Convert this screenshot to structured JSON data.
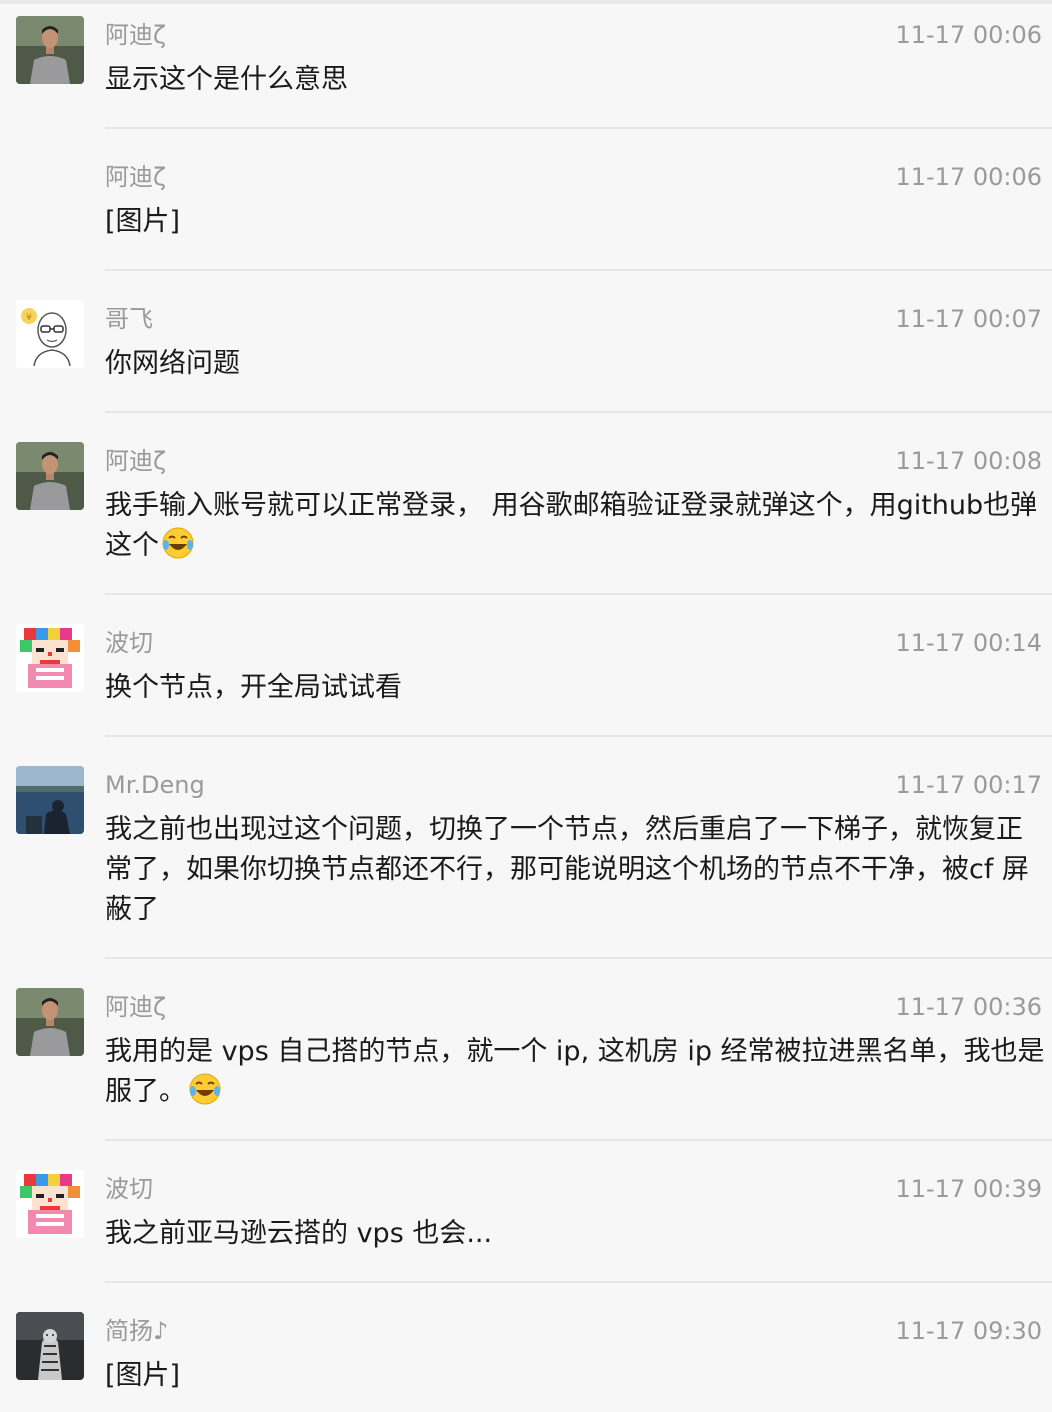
{
  "messages": [
    {
      "sender": "阿迪ζ",
      "time": "11-17 00:06",
      "avatar": "young-man-photo-avatar",
      "parts": [
        {
          "text": "显示这个是什么意思"
        }
      ]
    },
    {
      "sender": "阿迪ζ",
      "time": "11-17 00:06",
      "avatar": "",
      "parts": [
        {
          "text": "[图片]"
        }
      ]
    },
    {
      "sender": "哥飞",
      "time": "11-17 00:07",
      "avatar": "cartoon-glasses-avatar",
      "parts": [
        {
          "text": "你网络问题"
        }
      ]
    },
    {
      "sender": "阿迪ζ",
      "time": "11-17 00:08",
      "avatar": "young-man-photo-avatar",
      "parts": [
        {
          "text": "我手输入账号就可以正常登录， 用谷歌邮箱验证登录就弹这个，用github也弹这个"
        },
        {
          "emoji": "laughing-tears-emoji"
        }
      ]
    },
    {
      "sender": "波切",
      "time": "11-17 00:14",
      "avatar": "pixel-clown-avatar",
      "parts": [
        {
          "text": "换个节点，开全局试试看"
        }
      ]
    },
    {
      "sender": "Mr.Deng",
      "time": "11-17 00:17",
      "avatar": "lake-photo-avatar",
      "parts": [
        {
          "text": "我之前也出现过这个问题，切换了一个节点，然后重启了一下梯子，就恢复正常了，如果你切换节点都还不行，那可能说明这个机场的节点不干净，被cf 屏蔽了"
        }
      ]
    },
    {
      "sender": "阿迪ζ",
      "time": "11-17 00:36",
      "avatar": "young-man-photo-avatar",
      "parts": [
        {
          "text": "我用的是 vps 自己搭的节点，就一个 ip, 这机房 ip 经常被拉进黑名单，我也是服了。"
        },
        {
          "emoji": "laughing-tears-emoji"
        }
      ]
    },
    {
      "sender": "波切",
      "time": "11-17 00:39",
      "avatar": "pixel-clown-avatar",
      "parts": [
        {
          "text": "我之前亚马逊云搭的 vps 也会..."
        }
      ]
    },
    {
      "sender": "简扬♪",
      "time": "11-17 09:30",
      "avatar": "tiger-art-avatar",
      "parts": [
        {
          "text": "[图片]"
        }
      ]
    }
  ],
  "colors": {
    "background": "#f7f7f7",
    "meta_text": "#9a9a9a",
    "body_text": "#1a1a1a",
    "divider": "#e6e6e6"
  }
}
